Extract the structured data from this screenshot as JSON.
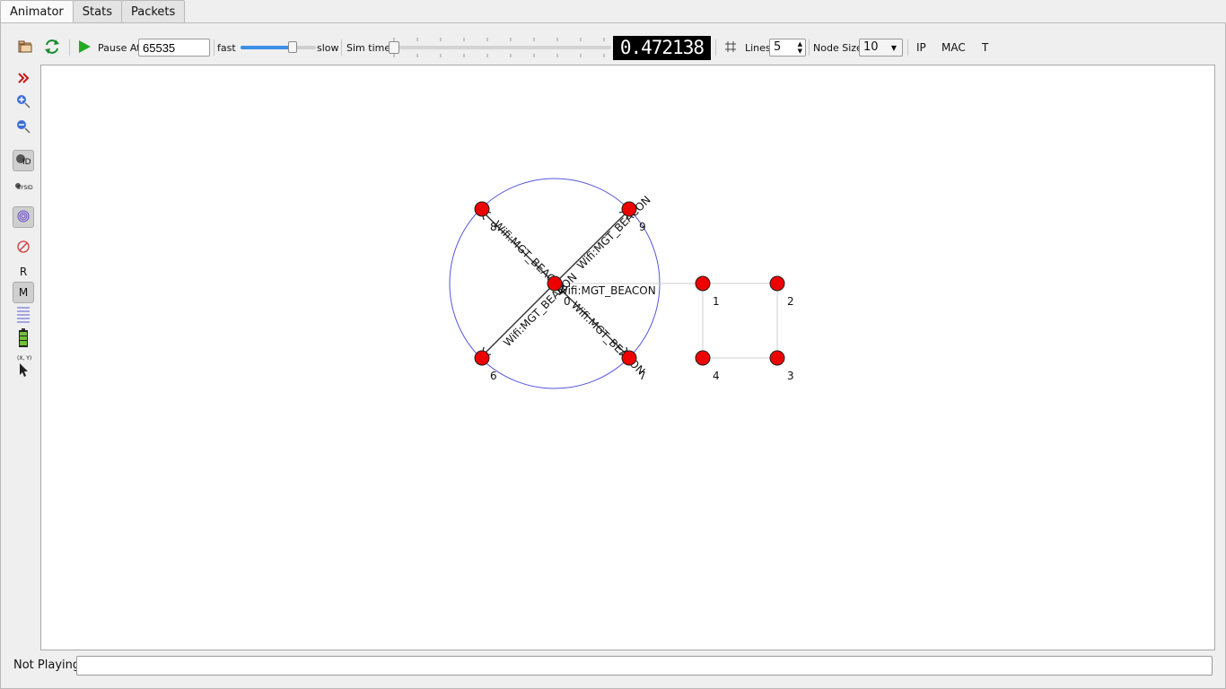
{
  "tabs": [
    {
      "label": "Animator",
      "active": true
    },
    {
      "label": "Stats",
      "active": false
    },
    {
      "label": "Packets",
      "active": false
    }
  ],
  "toolbar": {
    "open_icon": "folder-open-icon",
    "reload_icon": "reload-icon",
    "play_icon": "play-icon",
    "pause_at_label": "Pause At",
    "pause_at_value": "65535",
    "fast_label": "fast",
    "slow_label": "slow",
    "speed_fraction": 0.72,
    "sim_time_label": "Sim time",
    "sim_time_fraction": 0.0,
    "sim_time_display": "0.472138",
    "grid_icon": "grid-icon",
    "lines_label": "Lines",
    "lines_value": "5",
    "node_size_label": "Node Size",
    "node_size_value": "10",
    "ip_label": "IP",
    "mac_label": "MAC",
    "t_label": "T"
  },
  "leftbar": {
    "items": [
      {
        "icon": "expand-chevrons-icon",
        "pressed": false
      },
      {
        "icon": "zoom-in-icon",
        "pressed": false
      },
      {
        "icon": "zoom-out-icon",
        "pressed": false
      },
      {
        "icon": "node-id-icon",
        "label": "ID",
        "pressed": true
      },
      {
        "icon": "sysid-icon",
        "label": "SYSID",
        "pressed": false
      },
      {
        "icon": "wireless-range-icon",
        "pressed": true
      },
      {
        "icon": "no-entry-icon",
        "pressed": false
      },
      {
        "icon": "r-text-icon",
        "label": "R",
        "pressed": false
      },
      {
        "icon": "m-text-icon",
        "label": "M",
        "pressed": true
      },
      {
        "icon": "list-lines-icon",
        "pressed": false
      },
      {
        "icon": "battery-icon",
        "pressed": false
      },
      {
        "icon": "xy-cursor-icon",
        "label": "(X, Y)",
        "pressed": false
      }
    ]
  },
  "canvas": {
    "nodes": [
      {
        "id": "0",
        "label": "0"
      },
      {
        "id": "1",
        "label": "1"
      },
      {
        "id": "2",
        "label": "2"
      },
      {
        "id": "3",
        "label": "3"
      },
      {
        "id": "4",
        "label": "4"
      },
      {
        "id": "6",
        "label": "6"
      },
      {
        "id": "7",
        "label": "7"
      },
      {
        "id": "8",
        "label": "8"
      },
      {
        "id": "9",
        "label": "9"
      }
    ],
    "packet_label": "Wifi:MGT_BEACON",
    "node_color": "#ee0000",
    "range_color": "#5555dd"
  },
  "status": {
    "text": "Not Playing"
  }
}
